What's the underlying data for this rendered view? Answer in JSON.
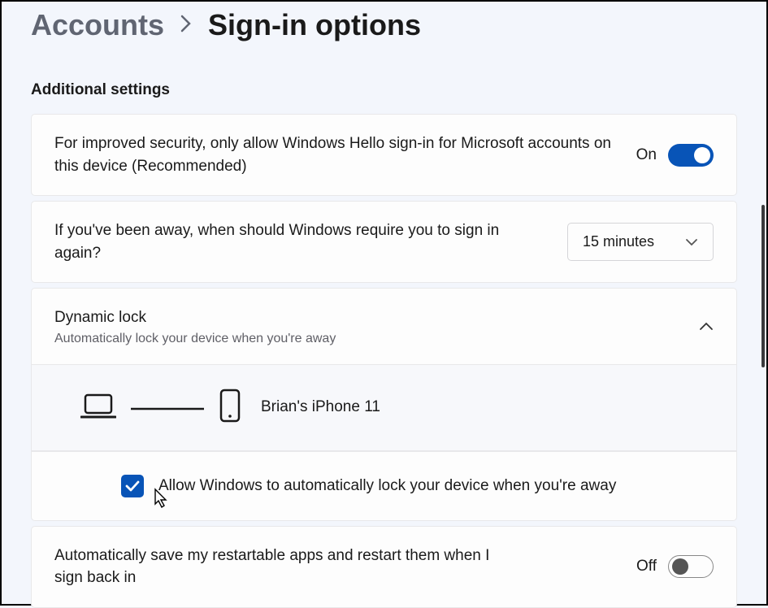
{
  "breadcrumb": {
    "parent": "Accounts",
    "current": "Sign-in options"
  },
  "section_header": "Additional settings",
  "hello_card": {
    "text": "For improved security, only allow Windows Hello sign-in for Microsoft accounts on this device (Recommended)",
    "state_label": "On",
    "on": true
  },
  "away_card": {
    "text": "If you've been away, when should Windows require you to sign in again?",
    "dropdown_value": "15 minutes"
  },
  "dynamic_lock": {
    "title": "Dynamic lock",
    "subtitle": "Automatically lock your device when you're away",
    "device_name": "Brian's iPhone 11",
    "checkbox_label": "Allow Windows to automatically lock your device when you're away",
    "checked": true
  },
  "restart_apps": {
    "text": "Automatically save my restartable apps and restart them when I sign back in",
    "state_label": "Off",
    "on": false
  }
}
